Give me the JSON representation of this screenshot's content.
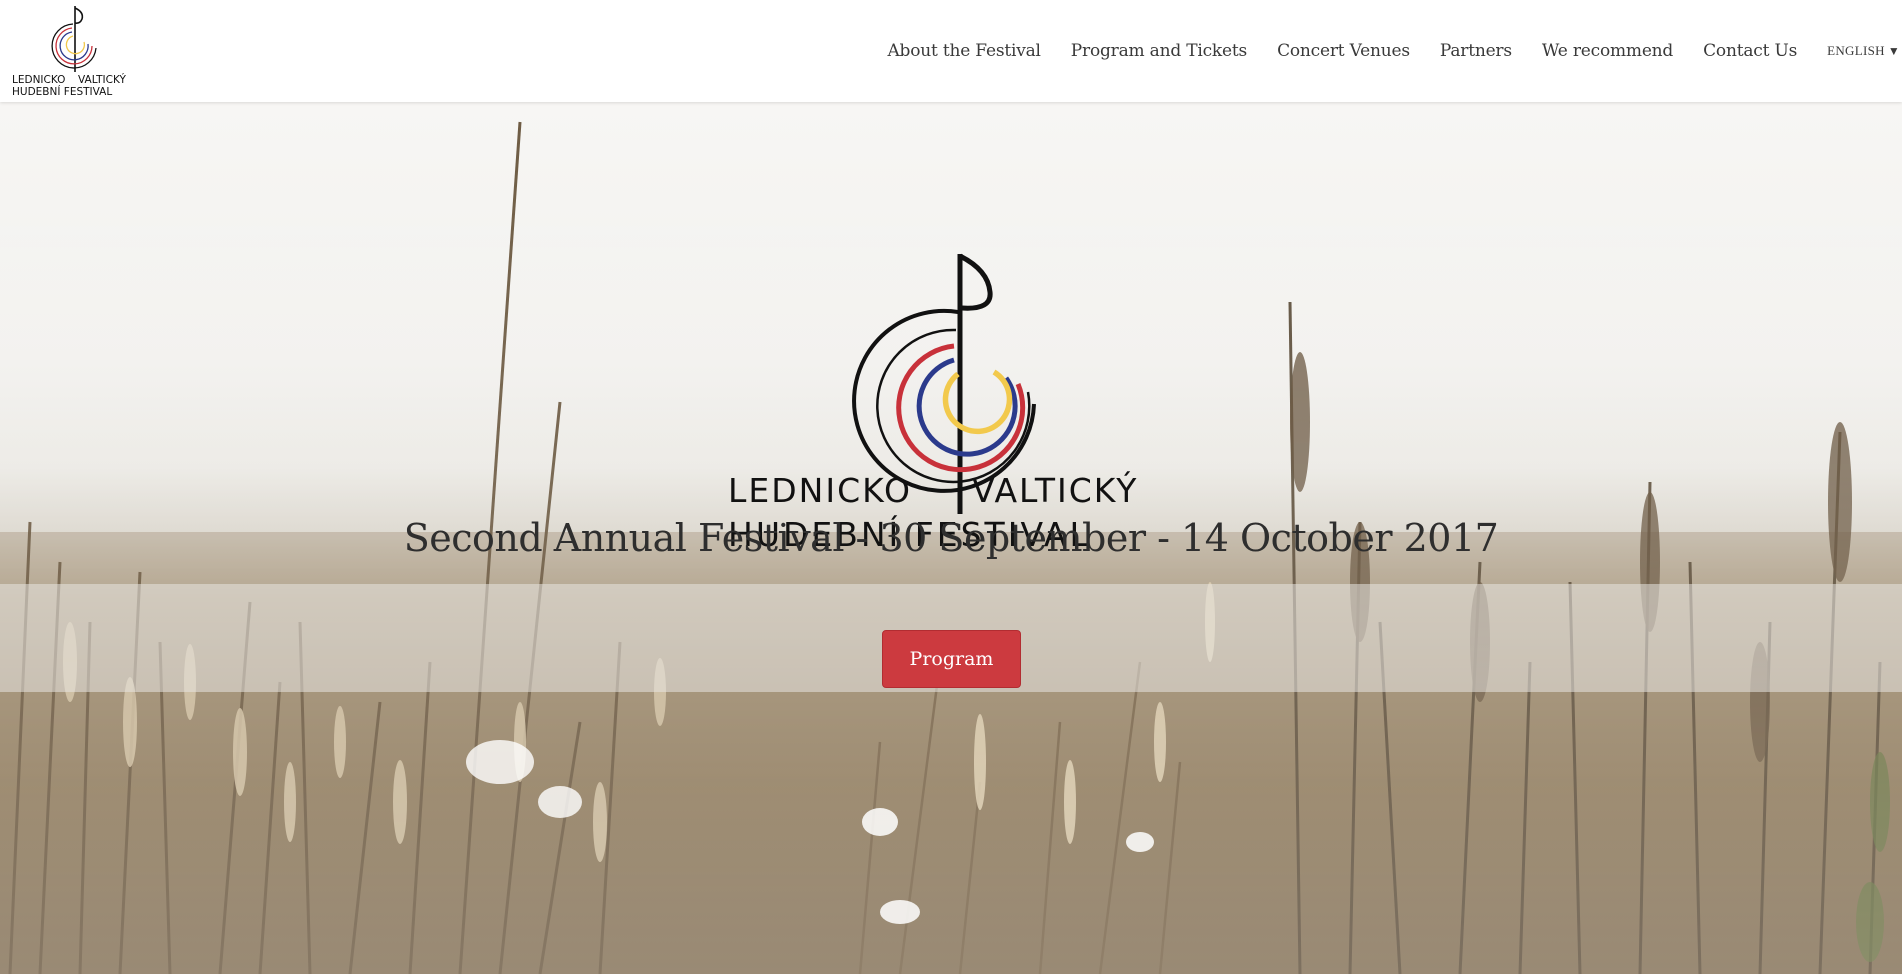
{
  "header": {
    "logo": {
      "line1_left": "LEDNICKO",
      "line1_right": "VALTICKÝ",
      "line2": "HUDEBNÍ FESTIVAL",
      "icon": "treble-clef-circles-logo"
    },
    "nav": [
      {
        "label": "About the Festival"
      },
      {
        "label": "Program and Tickets"
      },
      {
        "label": "Concert Venues"
      },
      {
        "label": "Partners"
      },
      {
        "label": "We recommend"
      },
      {
        "label": "Contact Us"
      }
    ],
    "language": {
      "label": "ENGLISH",
      "caret": "▼"
    }
  },
  "hero": {
    "logo": {
      "line1_left": "LEDNICKO",
      "line1_right": "VALTICKÝ",
      "line2": "HUDEBNÍ FESTIVAL",
      "arc_colors": [
        "#c8313a",
        "#2b3a8c",
        "#f2c94c",
        "#111111"
      ]
    },
    "tagline": "Second Annual Festival - 30 September - 14 October 2017",
    "button_label": "Program",
    "colors": {
      "button": "#cc3a3f"
    }
  }
}
